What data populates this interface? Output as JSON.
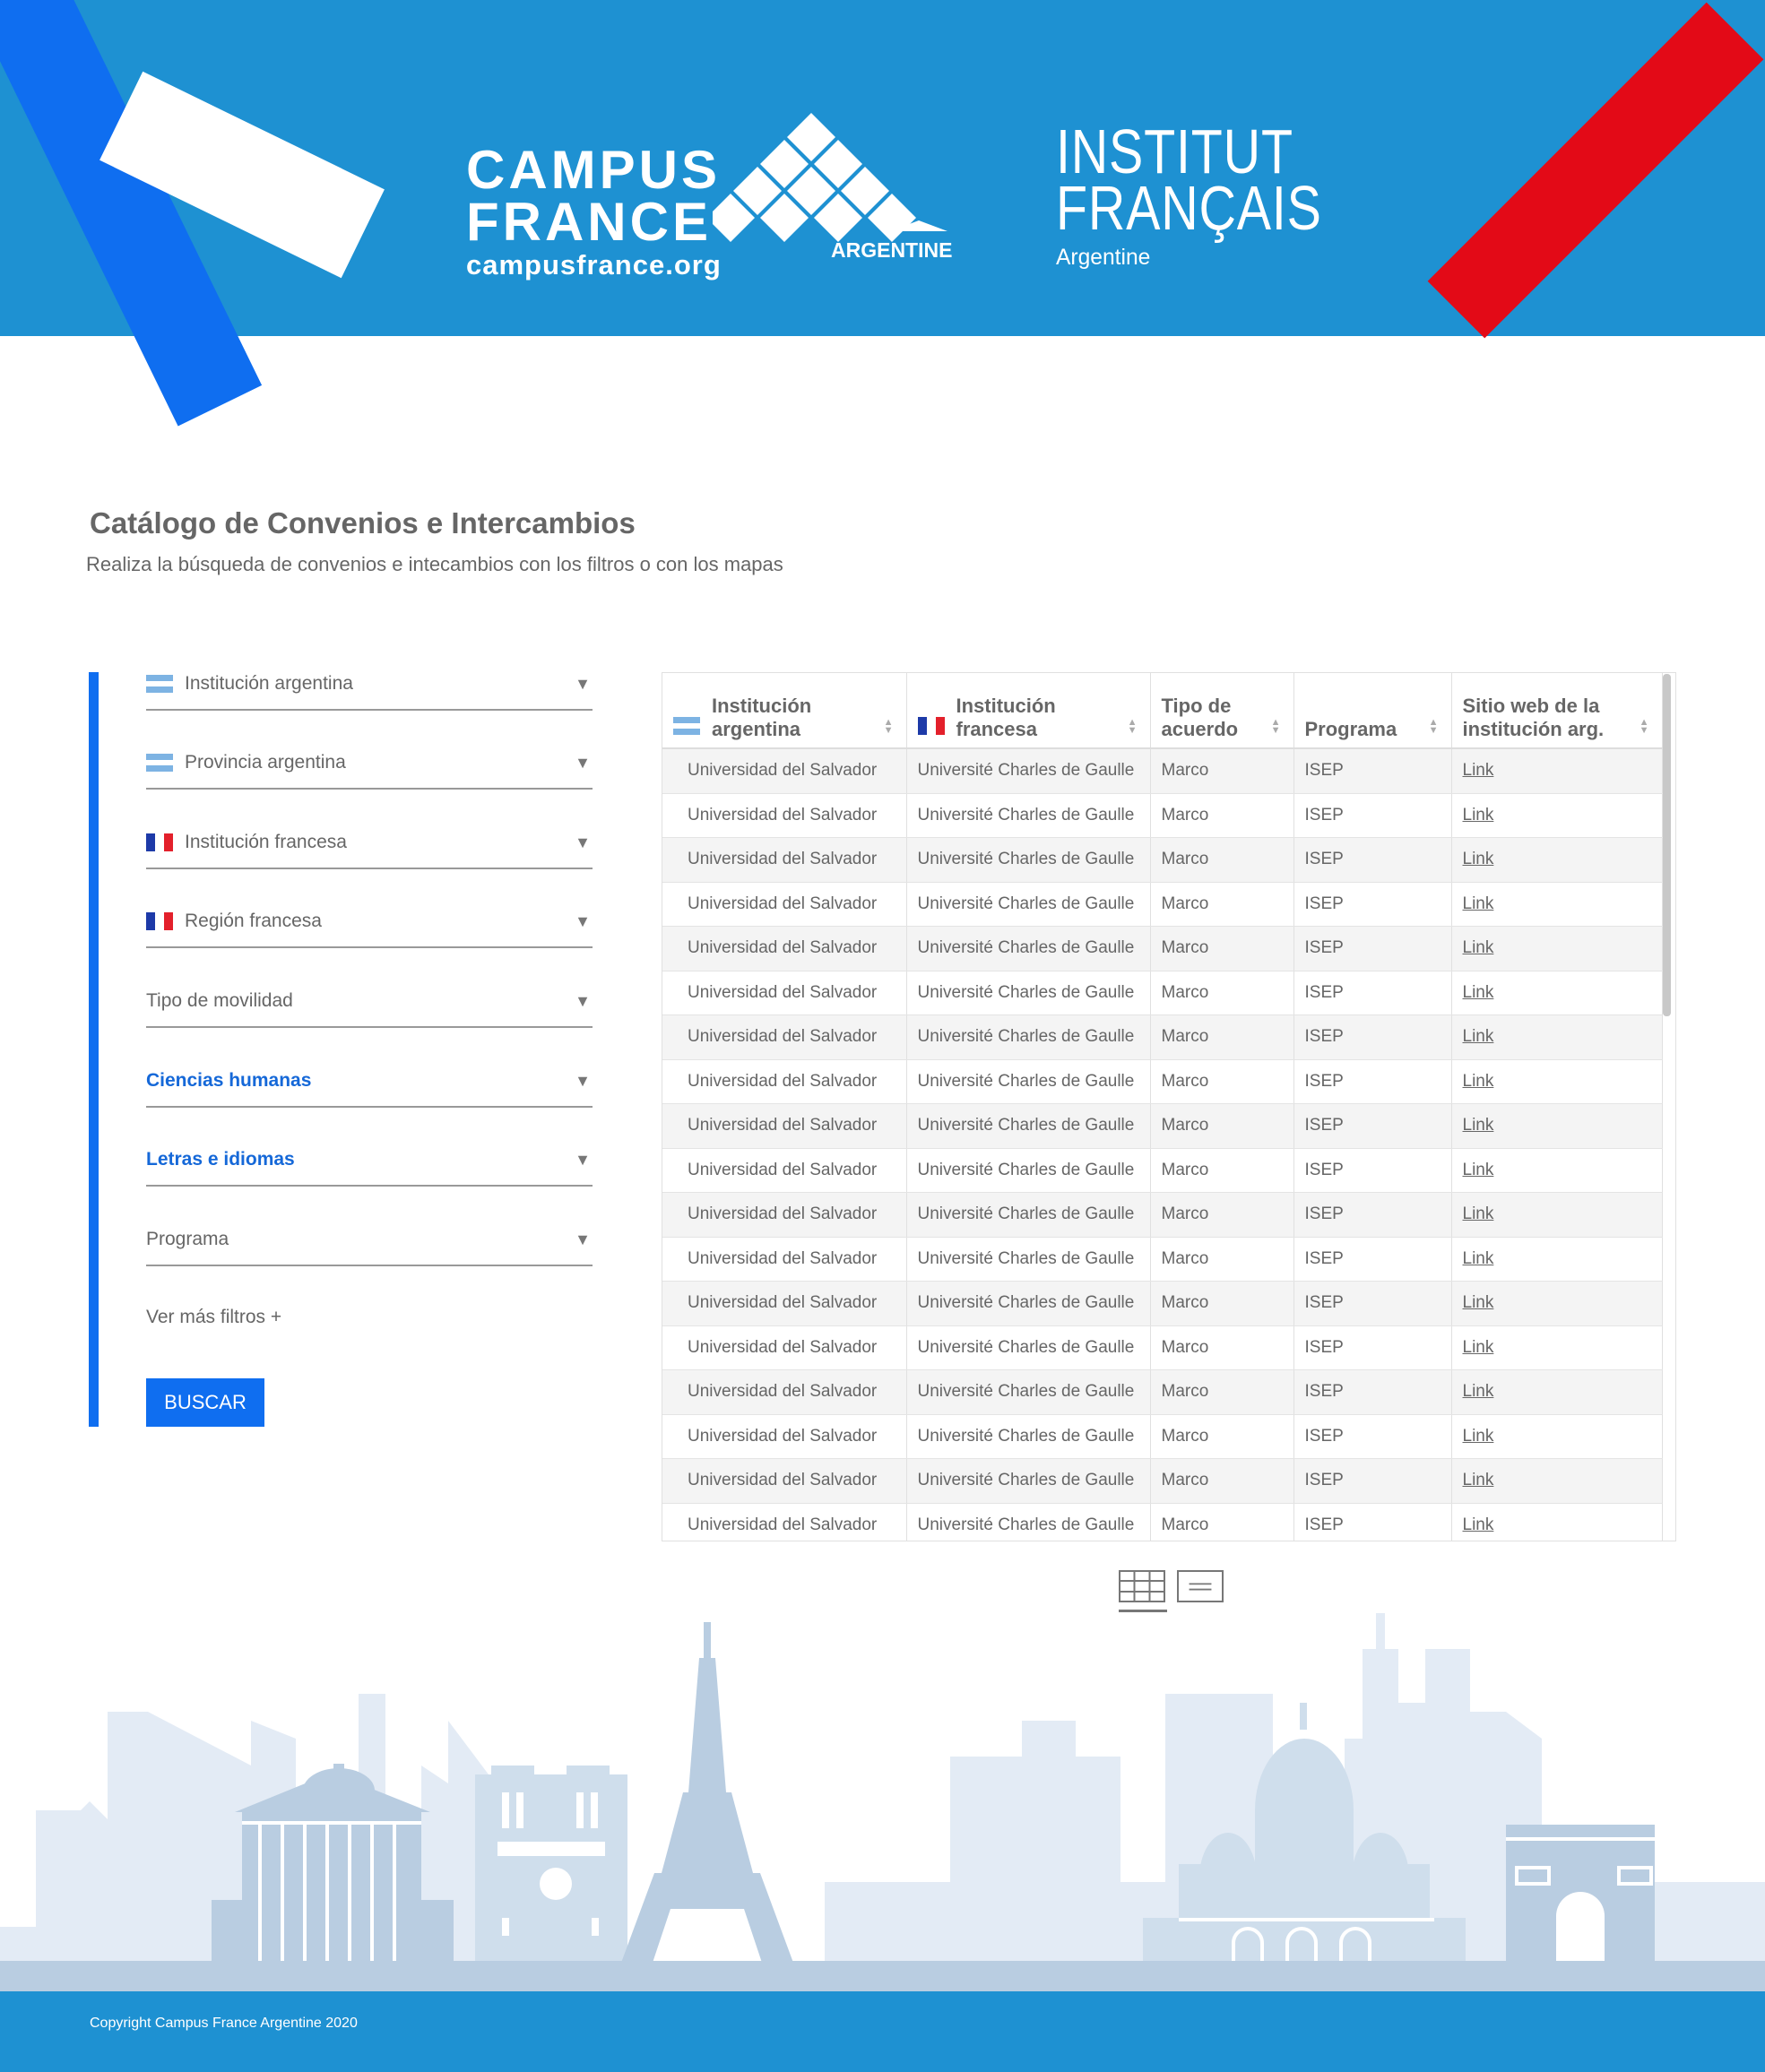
{
  "header": {
    "campus_line1": "CAMPUS",
    "campus_line2": "FRANCE",
    "campus_url": "campusfrance.org",
    "campus_country": "ARGENTINE",
    "institut_line1": "INSTITUT",
    "institut_line2": "FRANÇAIS",
    "institut_country": "Argentine"
  },
  "page": {
    "title": "Catálogo de Convenios e Intercambios",
    "subtitle": "Realiza la búsqueda de convenios e intecambios con los filtros o con los mapas"
  },
  "filters": [
    {
      "label": "Institución argentina",
      "flag": "argentina-flag-icon"
    },
    {
      "label": "Provincia argentina",
      "flag": "argentina-flag-icon"
    },
    {
      "label": "Institución francesa",
      "flag": "france-flag-icon"
    },
    {
      "label": "Región francesa",
      "flag": "france-flag-icon"
    },
    {
      "label": "Tipo de movilidad",
      "flag": ""
    },
    {
      "label": "Ciencias humanas",
      "flag": "",
      "selected": true
    },
    {
      "label": "Letras e idiomas",
      "flag": "",
      "selected": true
    },
    {
      "label": "Programa",
      "flag": ""
    }
  ],
  "more_filters_label": "Ver más filtros +",
  "search_button": "BUSCAR",
  "table": {
    "headers": [
      "Institución argentina",
      "Institución francesa",
      "Tipo de acuerdo",
      "Programa",
      "Sitio web de la institución arg."
    ],
    "rows": [
      [
        "Universidad del Salvador",
        "Université Charles de Gaulle",
        "Marco",
        "ISEP",
        "Link"
      ],
      [
        "Universidad del Salvador",
        "Université Charles de Gaulle",
        "Marco",
        "ISEP",
        "Link"
      ],
      [
        "Universidad del Salvador",
        "Université Charles de Gaulle",
        "Marco",
        "ISEP",
        "Link"
      ],
      [
        "Universidad del Salvador",
        "Université Charles de Gaulle",
        "Marco",
        "ISEP",
        "Link"
      ],
      [
        "Universidad del Salvador",
        "Université Charles de Gaulle",
        "Marco",
        "ISEP",
        "Link"
      ],
      [
        "Universidad del Salvador",
        "Université Charles de Gaulle",
        "Marco",
        "ISEP",
        "Link"
      ],
      [
        "Universidad del Salvador",
        "Université Charles de Gaulle",
        "Marco",
        "ISEP",
        "Link"
      ],
      [
        "Universidad del Salvador",
        "Université Charles de Gaulle",
        "Marco",
        "ISEP",
        "Link"
      ],
      [
        "Universidad del Salvador",
        "Université Charles de Gaulle",
        "Marco",
        "ISEP",
        "Link"
      ],
      [
        "Universidad del Salvador",
        "Université Charles de Gaulle",
        "Marco",
        "ISEP",
        "Link"
      ],
      [
        "Universidad del Salvador",
        "Université Charles de Gaulle",
        "Marco",
        "ISEP",
        "Link"
      ],
      [
        "Universidad del Salvador",
        "Université Charles de Gaulle",
        "Marco",
        "ISEP",
        "Link"
      ],
      [
        "Universidad del Salvador",
        "Université Charles de Gaulle",
        "Marco",
        "ISEP",
        "Link"
      ],
      [
        "Universidad del Salvador",
        "Université Charles de Gaulle",
        "Marco",
        "ISEP",
        "Link"
      ],
      [
        "Universidad del Salvador",
        "Université Charles de Gaulle",
        "Marco",
        "ISEP",
        "Link"
      ],
      [
        "Universidad del Salvador",
        "Université Charles de Gaulle",
        "Marco",
        "ISEP",
        "Link"
      ],
      [
        "Universidad del Salvador",
        "Université Charles de Gaulle",
        "Marco",
        "ISEP",
        "Link"
      ],
      [
        "Universidad del Salvador",
        "Université Charles de Gaulle",
        "Marco",
        "ISEP",
        "Link"
      ]
    ]
  },
  "view_toggle": {
    "grid_icon": "table-view-icon",
    "list_icon": "list-view-icon",
    "active": "table"
  },
  "footer": {
    "copyright": "Copyright Campus France Argentine 2020"
  },
  "colors": {
    "header_bg": "#1e91d2",
    "accent_blue": "#0f6ef0",
    "accent_red": "#e30a17",
    "selected_filter": "#1568d8",
    "skyline_light": "#e3ebf5",
    "skyline_dark": "#b9cde1"
  }
}
